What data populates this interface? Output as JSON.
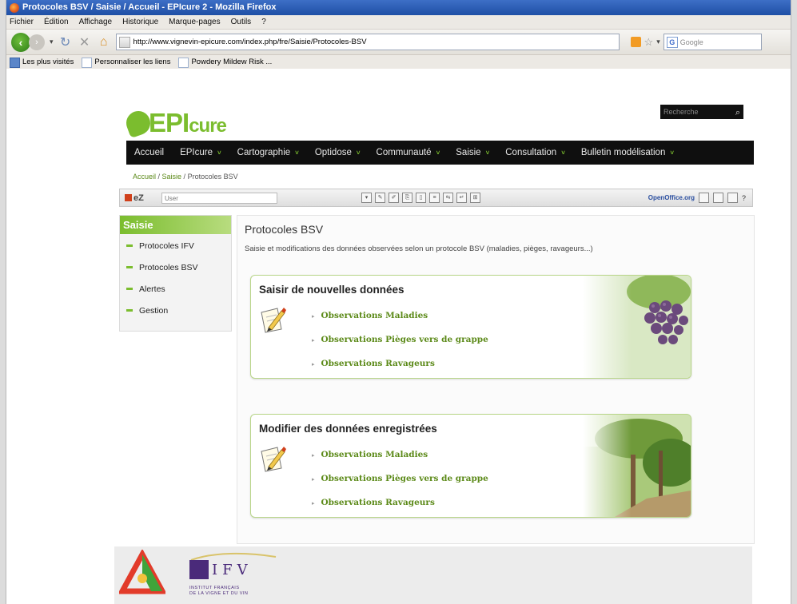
{
  "window": {
    "title": "Protocoles BSV / Saisie / Accueil - EPIcure 2 - Mozilla Firefox"
  },
  "menu": [
    "Fichier",
    "Édition",
    "Affichage",
    "Historique",
    "Marque-pages",
    "Outils",
    "?"
  ],
  "address": {
    "url": "http://www.vignevin-epicure.com/index.php/fre/Saisie/Protocoles-BSV",
    "search_placeholder": "Google"
  },
  "bookmarks": [
    "Les plus visités",
    "Personnaliser les liens",
    "Powdery Mildew Risk ..."
  ],
  "site": {
    "logo": {
      "main": "EPI",
      "suffix": "cure"
    },
    "search_placeholder": "Recherche",
    "nav": [
      "Accueil",
      "EPIcure",
      "Cartographie",
      "Optidose",
      "Communauté",
      "Saisie",
      "Consultation",
      "Bulletin modélisation"
    ],
    "breadcrumb": {
      "home": "Accueil",
      "sep1": " / ",
      "section": "Saisie",
      "sep2": " / ",
      "current": "Protocoles BSV"
    },
    "ez": {
      "logo": "eZ",
      "user_placeholder": "User",
      "oo_label": "OpenOffice.org",
      "help": "?"
    }
  },
  "sidebar": {
    "title": "Saisie",
    "items": [
      "Protocoles IFV",
      "Protocoles BSV",
      "Alertes",
      "Gestion"
    ]
  },
  "main": {
    "title": "Protocoles BSV",
    "description": "Saisie et modifications des données observées selon un protocole BSV (maladies, pièges, ravageurs...)",
    "cards": [
      {
        "title": "Saisir de nouvelles données",
        "links": [
          "Observations Maladies",
          "Observations Pièges vers de grappe",
          "Observations Ravageurs"
        ]
      },
      {
        "title": "Modifier des données enregistrées",
        "links": [
          "Observations Maladies",
          "Observations Pièges vers de grappe",
          "Observations Ravageurs"
        ]
      }
    ]
  },
  "footer": {
    "ifv": "IFV",
    "ifv_sub1": "INSTITUT FRANÇAIS",
    "ifv_sub2": "DE LA VIGNE ET DU VIN"
  },
  "colors": {
    "accent": "#7bbd2e",
    "link": "#5c8a19",
    "nav_bg": "#0f0f0f"
  }
}
